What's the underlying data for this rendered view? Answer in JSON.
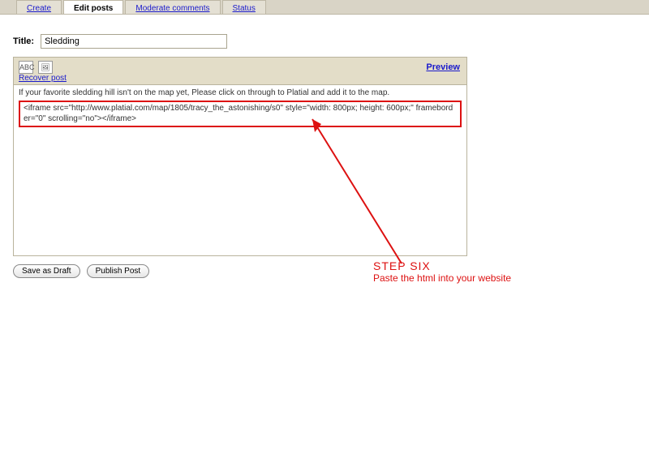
{
  "tabs": {
    "create": "Create",
    "edit_posts": "Edit posts",
    "moderate_comments": "Moderate comments",
    "status": "Status"
  },
  "title": {
    "label": "Title:",
    "value": "Sledding"
  },
  "toolbar": {
    "spellcheck_icon": "ABC",
    "image_icon": "🖼",
    "recover_post": "Recover post",
    "preview": "Preview"
  },
  "editor": {
    "intro_text": "If your favorite sledding hill isn't on the map yet, Please click on through to Platial and add it to the map.",
    "pasted_code": "<iframe src=\"http://www.platial.com/map/1805/tracy_the_astonishing/s0\" style=\"width: 800px; height: 600px;\" frameborder=\"0\" scrolling=\"no\"></iframe>"
  },
  "buttons": {
    "save_as_draft": "Save as Draft",
    "publish_post": "Publish Post"
  },
  "annotation": {
    "step": "STEP SIX",
    "caption": "Paste the html into your website"
  }
}
